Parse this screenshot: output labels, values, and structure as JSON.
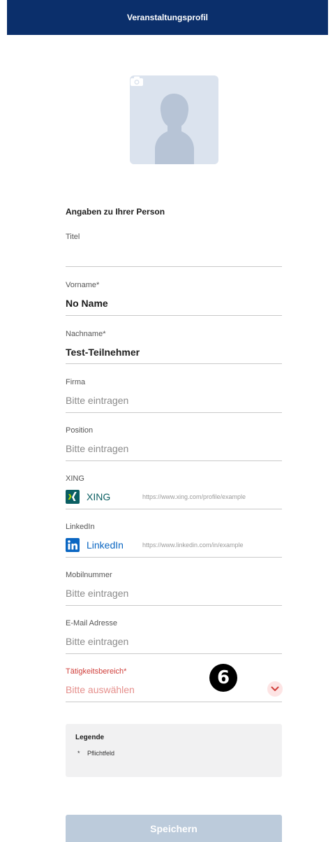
{
  "header": {
    "title": "Veranstaltungsprofil"
  },
  "avatar": {
    "icon": "person-silhouette-icon",
    "camera_icon": "camera-icon"
  },
  "section": {
    "title": "Angaben zu Ihrer Person"
  },
  "fields": {
    "titel": {
      "label": "Titel",
      "value": ""
    },
    "vorname": {
      "label": "Vorname*",
      "value": "No Name"
    },
    "nachname": {
      "label": "Nachname*",
      "value": "Test-Teilnehmer"
    },
    "firma": {
      "label": "Firma",
      "placeholder": "Bitte eintragen"
    },
    "position": {
      "label": "Position",
      "placeholder": "Bitte eintragen"
    },
    "xing": {
      "label": "XING",
      "name": "XING",
      "placeholder": "https://www.xing.com/profile/example",
      "color": "#0a5e62",
      "icon": "xing-icon"
    },
    "linkedin": {
      "label": "LinkedIn",
      "name": "LinkedIn",
      "placeholder": "https://www.linkedin.com/in/example",
      "color": "#0a66c2",
      "icon": "linkedin-icon"
    },
    "mobil": {
      "label": "Mobilnummer",
      "placeholder": "Bitte eintragen"
    },
    "email": {
      "label": "E-Mail Adresse",
      "placeholder": "Bitte eintragen"
    },
    "taetigkeit": {
      "label": "Tätigkeitsbereich*",
      "placeholder": "Bitte auswählen",
      "error_color": "#d0403c"
    }
  },
  "step_badge": "6",
  "legend": {
    "title": "Legende",
    "star": "*",
    "text": "Pflichtfeld"
  },
  "save_button": {
    "label": "Speichern"
  },
  "colors": {
    "header_bg": "#0b2f6b",
    "button_disabled": "#bccbdb"
  }
}
